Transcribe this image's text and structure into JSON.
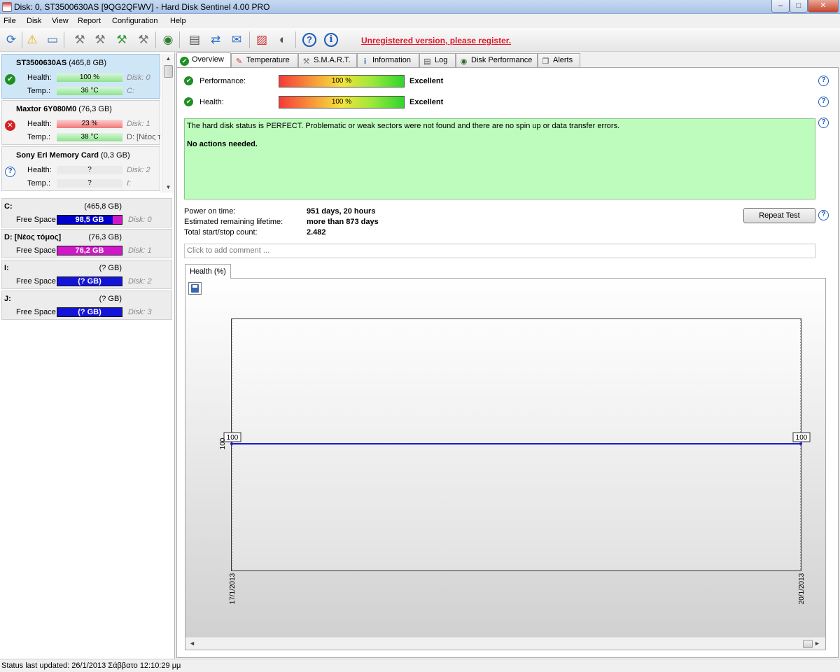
{
  "window": {
    "title": "Disk: 0, ST3500630AS [9QG2QFWV]  -  Hard Disk Sentinel 4.00 PRO",
    "min": "–",
    "max": "□",
    "close": "✕"
  },
  "menu": {
    "items": [
      "File",
      "Disk",
      "View",
      "Report",
      "Configuration",
      "Help"
    ]
  },
  "toolbar": {
    "register_text": "Unregistered version, please register."
  },
  "disks": [
    {
      "name": "ST3500630AS",
      "size": "(465,8 GB)",
      "status": "ok",
      "health_label": "Health:",
      "health_value": "100 %",
      "health_pct": 100,
      "temp_label": "Temp.:",
      "temp_value": "36 °C",
      "disk_label": "Disk: 0",
      "drive_label": "C:"
    },
    {
      "name": "Maxtor 6Y080M0",
      "size": "(76,3 GB)",
      "status": "bad",
      "health_label": "Health:",
      "health_value": "23 %",
      "health_pct": 23,
      "temp_label": "Temp.:",
      "temp_value": "38 °C",
      "disk_label": "Disk: 1",
      "drive_label": "D: [Νέος τ"
    },
    {
      "name": "Sony Eri Memory Card",
      "size": "(0,3 GB)",
      "status": "unknown",
      "health_label": "Health:",
      "health_value": "?",
      "temp_label": "Temp.:",
      "temp_value": "?",
      "disk_label": "Disk: 2",
      "drive_label": "I:"
    }
  ],
  "partitions": [
    {
      "name": "C:",
      "size": "(465,8 GB)",
      "free_label": "Free Space",
      "free_value": "98,5 GB",
      "disk": "Disk: 0"
    },
    {
      "name": "D: [Νέος τόμος]",
      "size": "(76,3 GB)",
      "free_label": "Free Space",
      "free_value": "76,2 GB",
      "disk": "Disk: 1"
    },
    {
      "name": "I:",
      "size": "(? GB)",
      "free_label": "Free Space",
      "free_value": "(? GB)",
      "disk": "Disk: 2"
    },
    {
      "name": "J:",
      "size": "(? GB)",
      "free_label": "Free Space",
      "free_value": "(? GB)",
      "disk": "Disk: 3"
    }
  ],
  "tabs": [
    "Overview",
    "Temperature",
    "S.M.A.R.T.",
    "Information",
    "Log",
    "Disk Performance",
    "Alerts"
  ],
  "overview": {
    "performance_label": "Performance:",
    "performance_value": "100 %",
    "performance_rating": "Excellent",
    "health_label": "Health:",
    "health_value": "100 %",
    "health_rating": "Excellent",
    "status_message": "The hard disk status is PERFECT. Problematic or weak sectors were not found and there are no spin up or data transfer errors.",
    "action_message": "No actions needed.",
    "power_on_label": "Power on time:",
    "power_on_value": "951 days, 20 hours",
    "lifetime_label": "Estimated remaining lifetime:",
    "lifetime_value": "more than 873 days",
    "startstop_label": "Total start/stop count:",
    "startstop_value": "2.482",
    "repeat_test": "Repeat Test",
    "comment_placeholder": "Click to add comment ...",
    "graph_tab": "Health (%)"
  },
  "chart_data": {
    "type": "line",
    "x": [
      "17/1/2013",
      "20/1/2013"
    ],
    "series": [
      {
        "values": [
          100,
          100
        ],
        "color": "#1a1ad0"
      }
    ],
    "y_tick": "100",
    "data_labels": [
      "100",
      "100"
    ]
  },
  "statusbar": {
    "text": "Status last updated: 26/1/2013 Σάββατο 12:10:29 μμ"
  }
}
